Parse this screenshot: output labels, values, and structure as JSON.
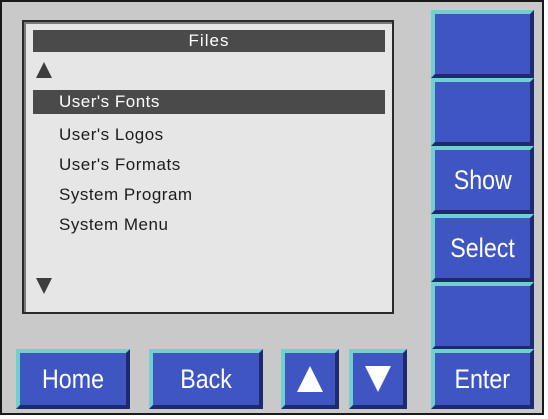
{
  "screen": {
    "title": "Files",
    "items": [
      {
        "label": "User's Fonts",
        "selected": true
      },
      {
        "label": "User's Logos",
        "selected": false
      },
      {
        "label": "User's Formats",
        "selected": false
      },
      {
        "label": "System Program",
        "selected": false
      },
      {
        "label": "System Menu",
        "selected": false
      }
    ]
  },
  "side_buttons": {
    "b1": "",
    "b2": "",
    "show": "Show",
    "select": "Select",
    "b5": "",
    "enter": "Enter"
  },
  "bottom_buttons": {
    "home": "Home",
    "back": "Back",
    "up_icon": "up-arrow-icon",
    "down_icon": "down-arrow-icon"
  },
  "colors": {
    "panel": "#c9c9c9",
    "screen": "#e6e6e6",
    "button": "#3e55c2",
    "button_highlight": "#70d0d0",
    "selection": "#4a4a4a"
  }
}
